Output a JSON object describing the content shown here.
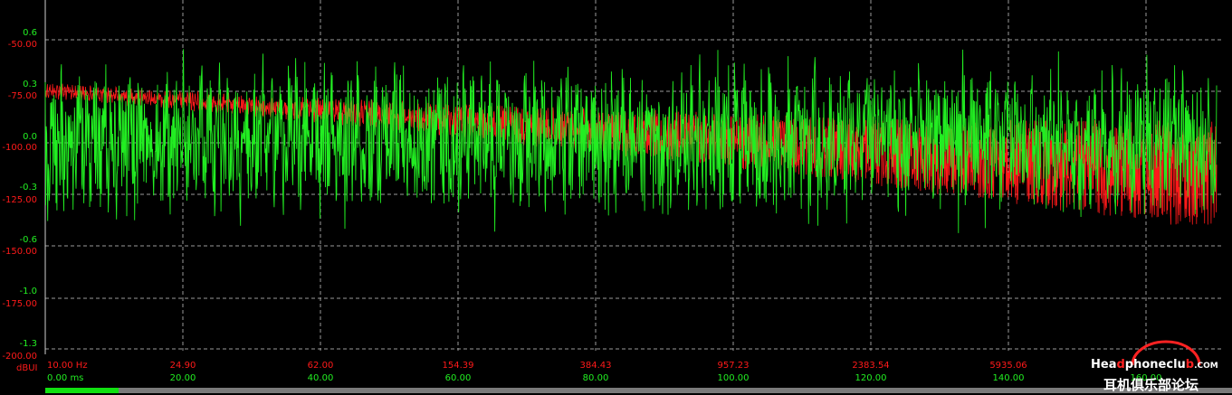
{
  "chart_data": {
    "type": "line",
    "grid": true,
    "background": "#000000",
    "colors": {
      "red": "#ff1a1a",
      "green": "#22ee22",
      "grid": "#9a9a9a"
    },
    "y_left_green": {
      "ticks": [
        "0.6",
        "0.3",
        "0.0",
        "-0.3",
        "-0.6",
        "-1.0",
        "-1.3"
      ],
      "ylim": [
        -1.3,
        0.6
      ]
    },
    "y_left_red": {
      "ticks": [
        "-50.00",
        "-75.00",
        "-100.00",
        "-125.00",
        "-150.00",
        "-175.00",
        "-200.00"
      ],
      "unit": "dBUI",
      "ylim": [
        -200,
        -50
      ]
    },
    "x_top_red": {
      "ticks": [
        "10.00 Hz",
        "24.90",
        "62.00",
        "154.39",
        "384.43",
        "957.23",
        "2383.54",
        "5935.06",
        ""
      ],
      "scale": "log"
    },
    "x_bottom_green": {
      "ticks": [
        "0.00 ms",
        "20.00",
        "40.00",
        "60.00",
        "80.00",
        "100.00",
        "120.00",
        "140.00",
        "160.00"
      ],
      "xlim": [
        0,
        170
      ]
    },
    "series": [
      {
        "color": "#ff1a1a",
        "axis": "frequency",
        "amplitude_range": [
          -200,
          -50
        ]
      },
      {
        "color": "#22ee22",
        "axis": "time",
        "amplitude_range": [
          -1.3,
          0.6
        ]
      }
    ]
  },
  "watermark": {
    "prefix": "Hea",
    "d": "d",
    "middle": "phoneclu",
    "b": "b",
    "suffix": ".COM",
    "cn": "耳机俱乐部论坛"
  },
  "scrollbar": {
    "position": 0.06
  }
}
